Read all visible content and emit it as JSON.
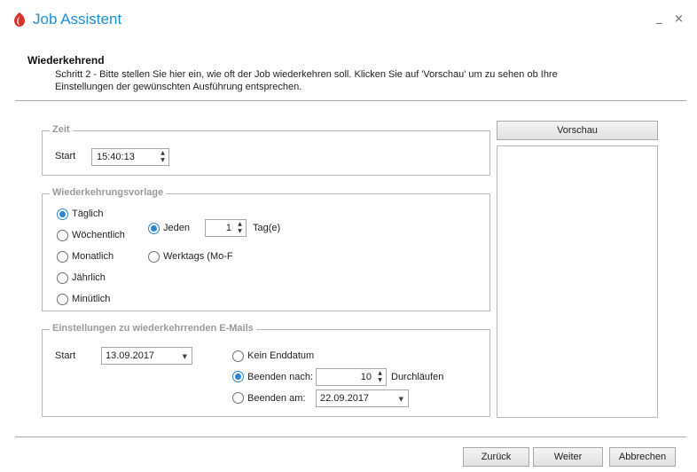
{
  "window": {
    "title": "Job Assistent",
    "minimize": "_",
    "close": "×"
  },
  "header": {
    "title": "Wiederkehrend",
    "description": "Schritt 2 - Bitte stellen Sie hier ein, wie oft der Job wiederkehren soll. Klicken Sie auf 'Vorschau' um zu sehen ob Ihre Einstellungen der gewünschten Ausführung entsprechen."
  },
  "zeit": {
    "legend": "Zeit",
    "start_label": "Start",
    "start_value": "15:40:13"
  },
  "vorlage": {
    "legend": "Wiederkehrungsvorlage",
    "options": [
      "Täglich",
      "Wöchentlich",
      "Monatlich",
      "Jährlich",
      "Minütlich"
    ],
    "selected": "Täglich",
    "jeden_label": "Jeden",
    "jeden_value": "1",
    "tag_label": "Tag(e)",
    "werktags_label": "Werktags (Mo-F"
  },
  "emails": {
    "legend": "Einstellungen zu wiederkehrrenden E-Mails",
    "start_label": "Start",
    "start_value": "13.09.2017",
    "kein_enddatum": "Kein Enddatum",
    "beenden_nach": "Beenden nach:",
    "beenden_nach_value": "10",
    "durchlaeufen": "Durchläufen",
    "beenden_am": "Beenden am:",
    "beenden_am_value": "22.09.2017"
  },
  "preview": {
    "button_label": "Vorschau"
  },
  "footer": {
    "back": "Zurück",
    "next": "Weiter",
    "cancel": "Abbrechen"
  },
  "colors": {
    "accent": "#1b8fd3",
    "radio": "#2b85d0",
    "app_icon": "#d9342b"
  }
}
